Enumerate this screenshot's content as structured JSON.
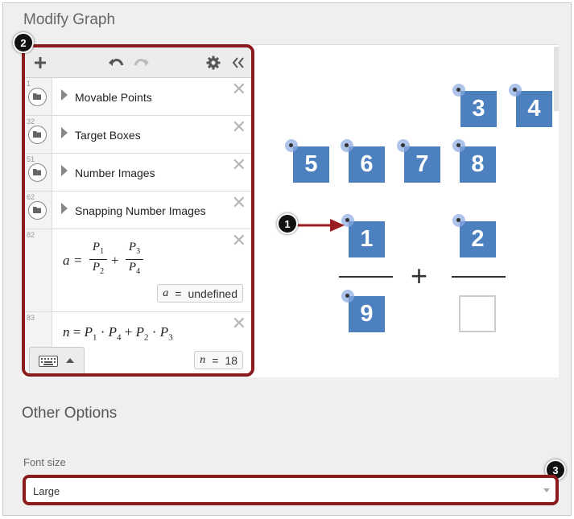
{
  "page": {
    "title": "Modify Graph",
    "other_options_title": "Other Options",
    "font_size_label": "Font size",
    "font_size_value": "Large"
  },
  "expressions": [
    {
      "num": "1",
      "label": "Movable Points",
      "type": "folder"
    },
    {
      "num": "32",
      "label": "Target Boxes",
      "type": "folder"
    },
    {
      "num": "51",
      "label": "Number Images",
      "type": "folder"
    },
    {
      "num": "62",
      "label": "Snapping Number Images",
      "type": "folder"
    },
    {
      "num": "82",
      "type": "formula",
      "lhs": "a",
      "eval_var": "a",
      "eval_eq": "=",
      "eval_value": "undefined"
    },
    {
      "num": "83",
      "type": "formula",
      "lhs": "n",
      "eval_var": "n",
      "eval_eq": "=",
      "eval_value": "18"
    }
  ],
  "math": {
    "eq": "=",
    "plus": "+",
    "dot": "·",
    "P": "P",
    "s1": "1",
    "s2": "2",
    "s3": "3",
    "s4": "4"
  },
  "tiles": {
    "t3": "3",
    "t4": "4",
    "t5": "5",
    "t6": "6",
    "t7": "7",
    "t8": "8",
    "t1": "1",
    "t2": "2",
    "t9": "9",
    "plus": "+"
  },
  "callouts": {
    "c1": "1",
    "c2": "2",
    "c3": "3"
  },
  "icons": {
    "add": "plus-icon",
    "undo": "undo-icon",
    "redo": "redo-icon",
    "settings": "gear-icon",
    "collapse": "double-chevron-left-icon",
    "delete": "close-icon",
    "folder": "folder-icon",
    "expand": "triangle-right-icon",
    "keyboard": "keyboard-icon",
    "caret": "caret-up-icon",
    "dropdown": "chevron-down-icon",
    "arrow": "arrow-right-icon"
  },
  "colors": {
    "highlight": "#8b1a1d",
    "tile": "#4d80bf",
    "point": "#8caae1"
  }
}
